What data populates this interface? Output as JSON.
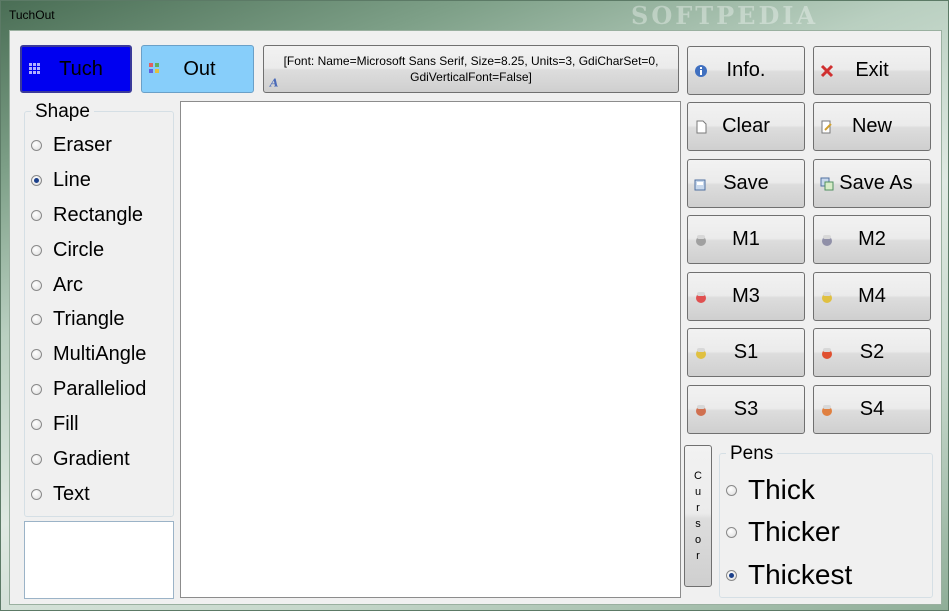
{
  "window": {
    "title": "TuchOut",
    "watermark": "SOFTPEDIA"
  },
  "top": {
    "tuch_label": "Tuch",
    "out_label": "Out",
    "font_text": "[Font: Name=Microsoft Sans Serif, Size=8.25, Units=3, GdiCharSet=0, GdiVerticalFont=False]"
  },
  "shape": {
    "legend": "Shape",
    "options": [
      "Eraser",
      "Line",
      "Rectangle",
      "Circle",
      "Arc",
      "Triangle",
      "MultiAngle",
      "Paralleliod",
      "Fill",
      "Gradient",
      "Text"
    ],
    "selected": "Line"
  },
  "buttons": {
    "info": "Info.",
    "exit": "Exit",
    "clear": "Clear",
    "new": "New",
    "save": "Save",
    "save_as": "Save As",
    "m1": "M1",
    "m2": "M2",
    "m3": "M3",
    "m4": "M4",
    "s1": "S1",
    "s2": "S2",
    "s3": "S3",
    "s4": "S4",
    "cursor": "Cursor"
  },
  "pens": {
    "legend": "Pens",
    "options": [
      "Thick",
      "Thicker",
      "Thickest"
    ],
    "selected": "Thickest"
  },
  "colors": {
    "tuch_bg": "#0000f0",
    "out_bg": "#87cefa",
    "m1": "#a0a0a0",
    "m2": "#9090a8",
    "m3": "#e05050",
    "m4": "#e0c040",
    "s1": "#e0c040",
    "s2": "#e05030",
    "s3": "#d07050",
    "s4": "#e08040"
  },
  "icons": {
    "tuch": "grid-icon",
    "out": "color-dots-icon",
    "font": "font-icon",
    "info": "info-icon",
    "exit": "close-icon",
    "clear": "document-icon",
    "new": "pencil-icon",
    "save": "save-icon",
    "save_as": "save-as-icon",
    "m": "capsule-icon"
  }
}
